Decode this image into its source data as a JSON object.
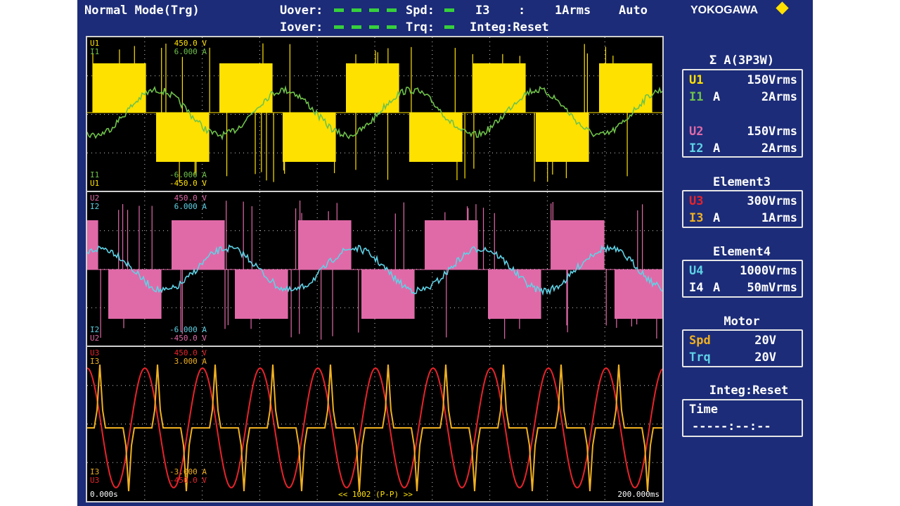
{
  "header": {
    "mode": "Normal Mode(Trg)",
    "uover_label": "Uover:",
    "iover_label": "Iover:",
    "spd_label": "Spd:",
    "trq_label": "Trq:",
    "current_range_name": "I3",
    "current_range_sep": ":",
    "current_range_value": "1Arms",
    "range_mode": "Auto",
    "integ_status": "Integ:Reset",
    "brand": "YOKOGAWA"
  },
  "colors": {
    "background": "#1c2c78",
    "u1": "#ffe100",
    "i1": "#6fc24a",
    "u2": "#e06aa8",
    "i2": "#5fd2e6",
    "u3": "#e8232a",
    "i3": "#f0b020",
    "lamp": "#37d03c",
    "text": "#ffffff"
  },
  "waveforms": {
    "panel1": {
      "u_name": "U1",
      "u_top": "450.0 V",
      "u_bottom": "-450.0 V",
      "i_name": "I1",
      "i_top": "6.000 A",
      "i_bottom": "-6.000 A"
    },
    "panel2": {
      "u_name": "U2",
      "u_top": "450.0 V",
      "u_bottom": "-450.0 V",
      "i_name": "I2",
      "i_top": "6.000 A",
      "i_bottom": "-6.000 A"
    },
    "panel3": {
      "u_name": "U3",
      "u_top": "450.0 V",
      "u_bottom": "-450.0 V",
      "i_name": "I3",
      "i_top": "3.000 A",
      "i_bottom": "-3.000 A"
    },
    "time_start": "0.000s",
    "time_end": "200.000ms",
    "record_info": "<< 1002 (P-P) >>"
  },
  "sidebar": {
    "sigma": {
      "title": "Σ A(3P3W)",
      "rows": [
        {
          "name": "U1",
          "suffix": "",
          "value": "150Vrms"
        },
        {
          "name": "I1",
          "suffix": "A",
          "value": "2Arms"
        },
        {
          "name": "U2",
          "suffix": "",
          "value": "150Vrms"
        },
        {
          "name": "I2",
          "suffix": "A",
          "value": "2Arms"
        }
      ]
    },
    "element3": {
      "title": "Element3",
      "rows": [
        {
          "name": "U3",
          "suffix": "",
          "value": "300Vrms"
        },
        {
          "name": "I3",
          "suffix": "A",
          "value": "1Arms"
        }
      ]
    },
    "element4": {
      "title": "Element4",
      "rows": [
        {
          "name": "U4",
          "suffix": "",
          "value": "1000Vrms"
        },
        {
          "name": "I4",
          "suffix": "A",
          "value": "50mVrms"
        }
      ]
    },
    "motor": {
      "title": "Motor",
      "rows": [
        {
          "name": "Spd",
          "value": "20V"
        },
        {
          "name": "Trq",
          "value": "20V"
        }
      ]
    },
    "integ": {
      "title": "Integ:Reset",
      "time_label": "Time",
      "time_value": "-----:--:--"
    }
  }
}
